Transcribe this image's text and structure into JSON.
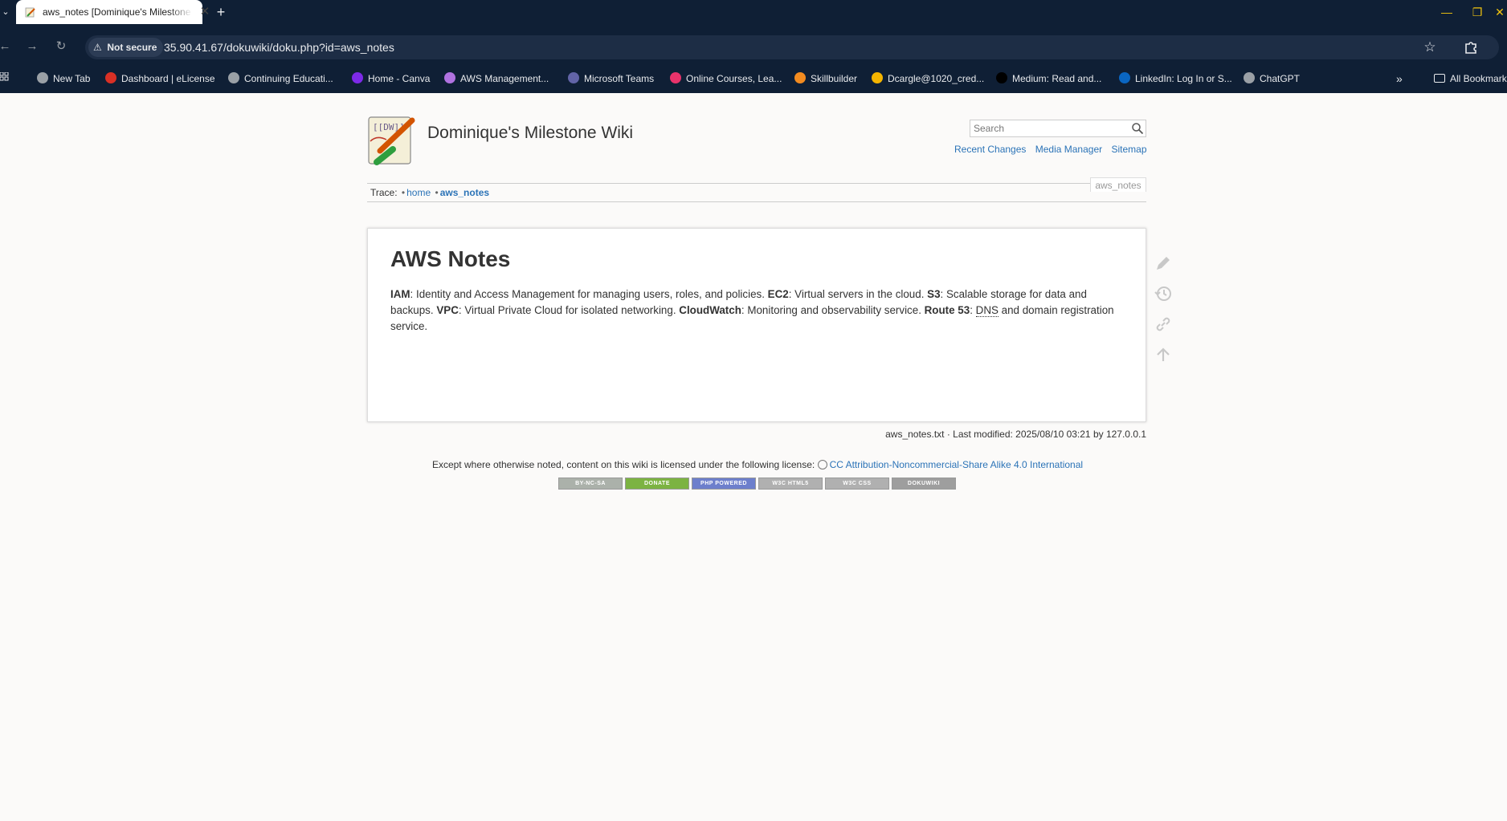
{
  "browser": {
    "tab": {
      "title": "aws_notes [Dominique's Milestone Wiki]"
    },
    "address": {
      "security_label": "Not secure",
      "url": "35.90.41.67/dokuwiki/doku.php?id=aws_notes"
    },
    "bookmarks": [
      {
        "label": "New Tab",
        "icon_color": "#9aa0a6"
      },
      {
        "label": "Dashboard | eLicense",
        "icon_color": "#d93025"
      },
      {
        "label": "Continuing Educati...",
        "icon_color": "#9aa0a6"
      },
      {
        "label": "Home - Canva",
        "icon_color": "#7d2ae8"
      },
      {
        "label": "AWS Management...",
        "icon_color": "#b072e0"
      },
      {
        "label": "Microsoft Teams",
        "icon_color": "#6264a7"
      },
      {
        "label": "Online Courses, Lea...",
        "icon_color": "#e8336b"
      },
      {
        "label": "Skillbuilder",
        "icon_color": "#f28b20"
      },
      {
        "label": "Dcargle@1020_cred...",
        "icon_color": "#f4b400"
      },
      {
        "label": "Medium: Read and...",
        "icon_color": "#000000"
      },
      {
        "label": "LinkedIn: Log In or S...",
        "icon_color": "#0a66c2"
      },
      {
        "label": "ChatGPT",
        "icon_color": "#9aa0a6"
      }
    ],
    "all_bookmarks_label": "All Bookmarks"
  },
  "wiki": {
    "title": "Dominique's Milestone Wiki",
    "search": {
      "placeholder": "Search"
    },
    "tools": [
      "Recent Changes",
      "Media Manager",
      "Sitemap"
    ],
    "trace": {
      "label": "Trace:",
      "items": [
        "home",
        "aws_notes"
      ]
    },
    "page_id": "aws_notes",
    "heading": "AWS Notes",
    "paragraph": [
      {
        "term": "IAM",
        "text": ": Identity and Access Management for managing users, roles, and policies. "
      },
      {
        "term": "EC2",
        "text": ": Virtual servers in the cloud. "
      },
      {
        "term": "S3",
        "text": ": Scalable storage for data and backups. "
      },
      {
        "term": "VPC",
        "text": ": Virtual Private Cloud for isolated networking. "
      },
      {
        "term": "CloudWatch",
        "text": ": Monitoring and observability service. "
      },
      {
        "term": "Route 53",
        "text": ": "
      }
    ],
    "paragraph_tail": {
      "abbr": "DNS",
      "text": " and domain registration service."
    },
    "docinfo": "aws_notes.txt · Last modified: 2025/08/10 03:21 by 127.0.0.1",
    "license": {
      "text": "Except where otherwise noted, content on this wiki is licensed under the following license:",
      "link": "CC Attribution-Noncommercial-Share Alike 4.0 International"
    },
    "badges": [
      {
        "label": "BY-NC-SA",
        "color": "#abb1aa"
      },
      {
        "label": "DONATE",
        "color": "#7cb342"
      },
      {
        "label": "PHP POWERED",
        "color": "#6d7fcc"
      },
      {
        "label": "W3C HTML5",
        "color": "#b0b0b0"
      },
      {
        "label": "W3C CSS",
        "color": "#b0b0b0"
      },
      {
        "label": "DOKUWIKI",
        "color": "#9e9e9e"
      }
    ]
  }
}
